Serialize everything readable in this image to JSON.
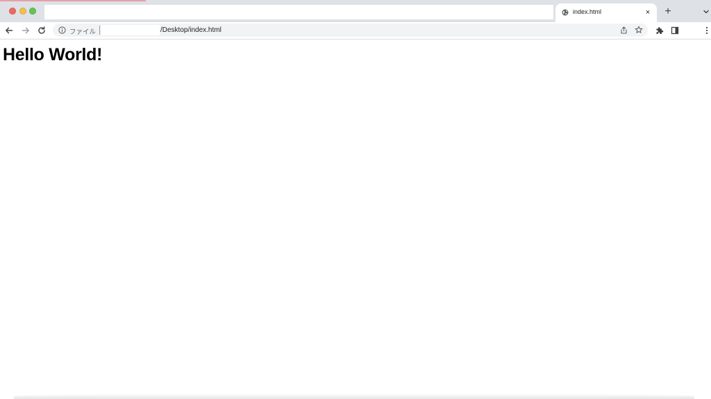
{
  "colors": {
    "tabstrip_bg": "#dee1e6",
    "omnibox_bg": "#f1f3f4",
    "icon": "#5f6368",
    "text": "#202124"
  },
  "window": {
    "traffic_lights": [
      "close",
      "minimize",
      "zoom"
    ]
  },
  "tabs": [
    {
      "title": "index.html",
      "favicon": "globe-icon",
      "close_glyph": "×",
      "active": true
    }
  ],
  "tabstrip": {
    "new_tab_glyph": "+",
    "search_icon": "chevron-down-icon"
  },
  "toolbar": {
    "back_icon": "arrow-left-icon",
    "forward_icon": "arrow-right-icon",
    "reload_icon": "reload-icon",
    "extensions_icon": "puzzle-icon",
    "side_panel_icon": "side-panel-icon",
    "menu_icon": "kebab-menu-icon"
  },
  "omnibox": {
    "info_icon": "info-icon",
    "scheme_label": "ファイル",
    "url": "/Desktop/index.html",
    "share_icon": "share-icon",
    "bookmark_icon": "star-icon"
  },
  "page": {
    "heading": "Hello World!"
  }
}
